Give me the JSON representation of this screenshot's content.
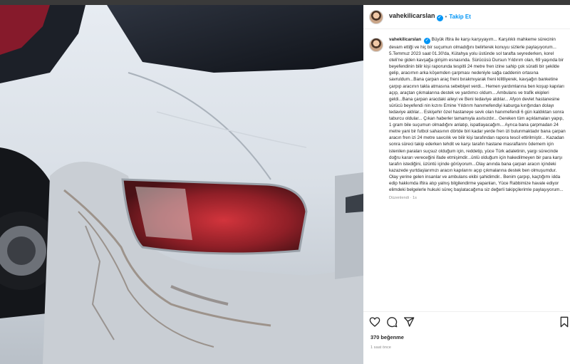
{
  "post": {
    "username": "vahekilicarslan",
    "verified_mark": "✓",
    "separator": "•",
    "follow_label": "Takip Et",
    "caption": "Büyük iftira ile karşı karşıyayım... Karşılıklı mahkeme sürecinin devam ettiği ve hiç bir suçumun olmadığını belirterek konuyu sizlerle paylaşıyorum... 5.Temmuz 2023 saat 01.30'da, Kütahya yolu üstünde sol tarafta seyrederken, korel oteli'ne giden kavşağa girişim esnasında. Sürücüsü Dursun Yıldırım olan, 69 yaşında bir beyefendinin bilir kişi raporunda tespitli 24 metre fren izine sahip çok süratli bir şekilde gelip, aracımın arka köşemden çarpması nedeniyle sağa caddenin ortasına savruldum...Bana çarpan araç freni bırakmıyarak freni kilitliyerek, kavşağın banketine çarpıp aracının takla atmasına sebebiyet verdi... Hemen yardımlarına ben koşup kapıları açıp, araçtan çıkmalarına destek ve yardımcı oldum....Ambulans ve trafik ekipleri geldi...Bana çarpan aracdaki aileyi ve Beni tedaviye aldılar... Afyon devlet hastanesine sürücü beyefendi nin kızını Emine Yıldırım hanımefendiyi kaburga kırığından dolayı tedaviye aldılar... Eskişehir özel hastaneye sevk olan hanımefendi 6 gün kaldıktan sonra taburcu oldular... Çıkan haberler tamamıyla asılsızdır... Gereken tüm açıklamaları yapıp, 1 gram bile suçumun olmadığını anlatıp, ispatlayacağım... Ayrıca bana çarpmadan 24 metre yani bir futbol sahasının dörtde biri kadar yerde fren izi bulunmaktadır bana çarpan aracın fren izi 24 metre savcılık ve bilir kişi tarafından rapora tescil ettirilmiştir... Kazadan sonra süreci takip ederken tehdit ve karşı tarafın hastane masraflarını ödemem için istenilen paraları suçsuz olduğum için, reddetip, yüce Türk adaletinin, yargı sürecinde doğru kararı vereceğini ifade etmişimdir...ünlü olduğum için hakedilmeyen bir para karşı tarafın istediğini, üzüntü içinde görüyorum...Olay anında bana çarpan aracın içindeki kazazede yurtdaşlarımızı aracın kapılarını açıp çıkmalarına destek ben olmuşumdur. Olay yerine gelen insanlar ve ambulans ekibi şahidimdir.. Benim çarpıp, kaçtığımı idda edip hakkımda iftira atıp yalnış bilgilendirme yapanları, Yüce Rabbimize havale ediyor elimdeki belgelerle hukuki süreç başlatacağıma siz değerli takipçilerimle paylaşıyorum...",
    "edited_label": "Düzenlendi · 1s",
    "likes_label": "370 beğenme",
    "time_label": "1 saat önce"
  },
  "icons": {
    "avatar": "avatar",
    "verified": "verified-badge-icon",
    "like": "heart-icon",
    "comment": "comment-icon",
    "share": "send-icon",
    "save": "bookmark-icon"
  },
  "colors": {
    "link": "#0095f6",
    "text": "#262626",
    "muted": "#8e8e8e"
  }
}
